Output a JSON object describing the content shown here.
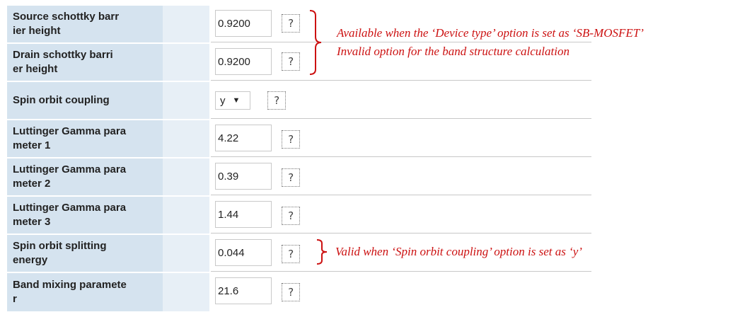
{
  "rows": [
    {
      "label": "Source schottky barr\nier height",
      "value": "0.9200",
      "help": "?"
    },
    {
      "label": "Drain schottky barri\ner height",
      "value": "0.9200",
      "help": "?"
    },
    {
      "label": "Spin orbit coupling",
      "value": "y",
      "help": "?"
    },
    {
      "label": "Luttinger Gamma para\nmeter 1",
      "value": "4.22",
      "help": "?"
    },
    {
      "label": "Luttinger Gamma para\nmeter 2",
      "value": "0.39",
      "help": "?"
    },
    {
      "label": "Luttinger Gamma para\nmeter 3",
      "value": "1.44",
      "help": "?"
    },
    {
      "label": "Spin orbit splitting\nenergy",
      "value": "0.044",
      "help": "?"
    },
    {
      "label": "Band mixing paramete\nr",
      "value": "21.6",
      "help": "?"
    }
  ],
  "select_caret": "▼",
  "annotations": {
    "schottky_line1": "Available when the ‘Device type’ option is set as ‘SB-MOSFET’",
    "schottky_line2": "Invalid option for the band structure calculation",
    "spin_orbit": "Valid when ‘Spin orbit coupling’ option is set as ‘y’"
  },
  "colors": {
    "label_bg": "#d5e3ef",
    "spacer_bg": "#e7eff6",
    "annotation": "#cc1111"
  }
}
